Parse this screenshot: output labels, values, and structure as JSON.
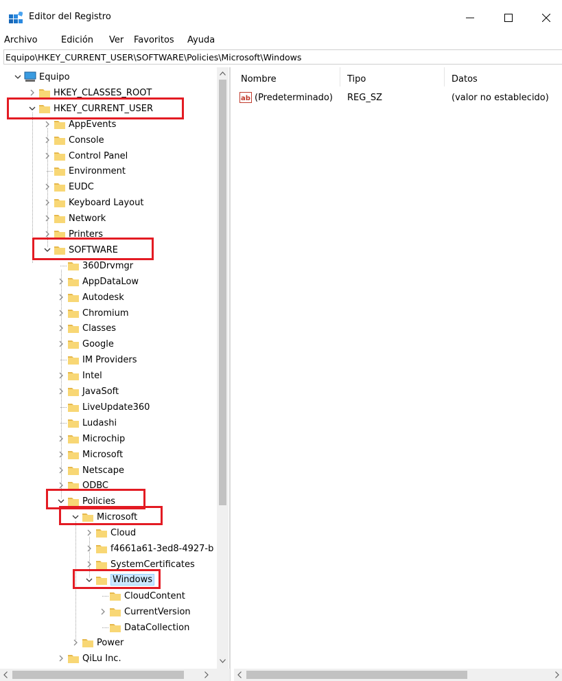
{
  "window": {
    "title": "Editor del Registro",
    "controls": {
      "minimize": "—",
      "maximize": "☐",
      "close": "✕"
    }
  },
  "menu": [
    "Archivo",
    "Edición",
    "Ver",
    "Favoritos",
    "Ayuda"
  ],
  "address": "Equipo\\HKEY_CURRENT_USER\\SOFTWARE\\Policies\\Microsoft\\Windows",
  "tree": [
    {
      "label": "Equipo",
      "expanded": true,
      "icon": "computer-icon"
    },
    {
      "label": "HKEY_CLASSES_ROOT",
      "expanded": false
    },
    {
      "label": "HKEY_CURRENT_USER",
      "expanded": true
    },
    {
      "label": "AppEvents",
      "expanded": false
    },
    {
      "label": "Console",
      "expanded": false
    },
    {
      "label": "Control Panel",
      "expanded": false
    },
    {
      "label": "Environment",
      "expanded": null
    },
    {
      "label": "EUDC",
      "expanded": false
    },
    {
      "label": "Keyboard Layout",
      "expanded": false
    },
    {
      "label": "Network",
      "expanded": false
    },
    {
      "label": "Printers",
      "expanded": false
    },
    {
      "label": "SOFTWARE",
      "expanded": true
    },
    {
      "label": "360Drvmgr",
      "expanded": null
    },
    {
      "label": "AppDataLow",
      "expanded": false
    },
    {
      "label": "Autodesk",
      "expanded": false
    },
    {
      "label": "Chromium",
      "expanded": false
    },
    {
      "label": "Classes",
      "expanded": false
    },
    {
      "label": "Google",
      "expanded": false
    },
    {
      "label": "IM Providers",
      "expanded": null
    },
    {
      "label": "Intel",
      "expanded": false
    },
    {
      "label": "JavaSoft",
      "expanded": false
    },
    {
      "label": "LiveUpdate360",
      "expanded": null
    },
    {
      "label": "Ludashi",
      "expanded": null
    },
    {
      "label": "Microchip",
      "expanded": false
    },
    {
      "label": "Microsoft",
      "expanded": false
    },
    {
      "label": "Netscape",
      "expanded": false
    },
    {
      "label": "ODBC",
      "expanded": false
    },
    {
      "label": "Policies",
      "expanded": true
    },
    {
      "label": "Microsoft",
      "expanded": true
    },
    {
      "label": "Cloud",
      "expanded": false
    },
    {
      "label": "f4661a61-3ed8-4927-b",
      "expanded": false
    },
    {
      "label": "SystemCertificates",
      "expanded": false
    },
    {
      "label": "Windows",
      "expanded": true,
      "selected": true
    },
    {
      "label": "CloudContent",
      "expanded": null
    },
    {
      "label": "CurrentVersion",
      "expanded": false
    },
    {
      "label": "DataCollection",
      "expanded": null
    },
    {
      "label": "Power",
      "expanded": false
    },
    {
      "label": "QiLu Inc.",
      "expanded": false
    }
  ],
  "list": {
    "columns": [
      "Nombre",
      "Tipo",
      "Datos"
    ],
    "rows": [
      {
        "name": "(Predeterminado)",
        "type": "REG_SZ",
        "data": "(valor no establecido)",
        "icon": "string-value-icon"
      }
    ]
  },
  "scroll": {
    "up": "^",
    "down": "v",
    "left": "<",
    "right": ">"
  },
  "colors": {
    "highlight": "#e31b23",
    "selection": "#cce8ff",
    "folder": "#f8d775",
    "folder_dark": "#e6b84c"
  }
}
